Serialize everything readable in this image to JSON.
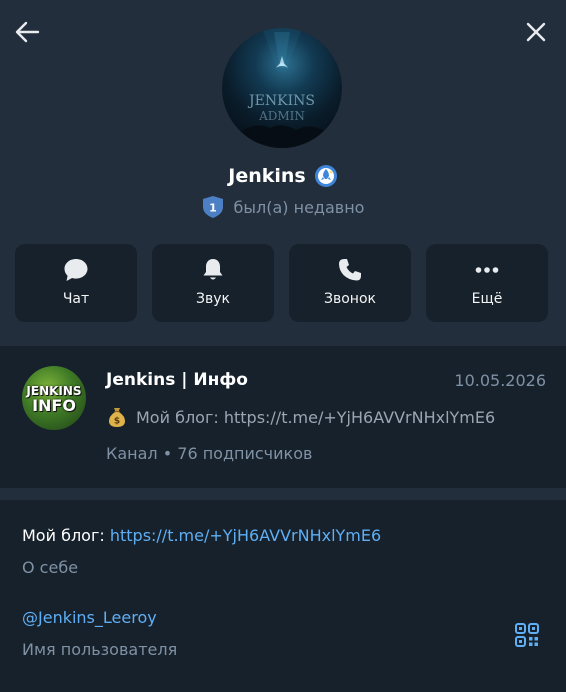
{
  "header": {
    "back_icon": "arrow-left-icon",
    "close_icon": "close-icon"
  },
  "profile": {
    "avatar_text": "JENKINS ADMIN",
    "name": "Jenkins",
    "badge_icon": "rocket-badge-icon",
    "level": "1",
    "status": "был(а) недавно"
  },
  "actions": [
    {
      "label": "Чат",
      "icon": "chat-icon"
    },
    {
      "label": "Звук",
      "icon": "bell-icon"
    },
    {
      "label": "Звонок",
      "icon": "phone-icon"
    },
    {
      "label": "Ещё",
      "icon": "more-icon"
    }
  ],
  "channel": {
    "avatar_line1": "JENKINS",
    "avatar_line2": "INFO",
    "title": "Jenkins | Инфо",
    "date": "10.05.2026",
    "message_icon": "money-bag-icon",
    "message": "Мой блог: https://t.me/+YjH6AVVrNHxlYmE6",
    "subtitle": "Канал • 76 подписчиков"
  },
  "info": {
    "bio_prefix": "Мой блог: ",
    "bio_link": "https://t.me/+YjH6AVVrNHxlYmE6",
    "bio_label": "О себе",
    "username": "@Jenkins_Leeroy",
    "username_label": "Имя пользователя",
    "qr_icon": "qr-code-icon"
  },
  "colors": {
    "panel": "#232e3c",
    "background": "#17212b",
    "accent": "#5eaff5",
    "muted": "#7f91a4"
  }
}
